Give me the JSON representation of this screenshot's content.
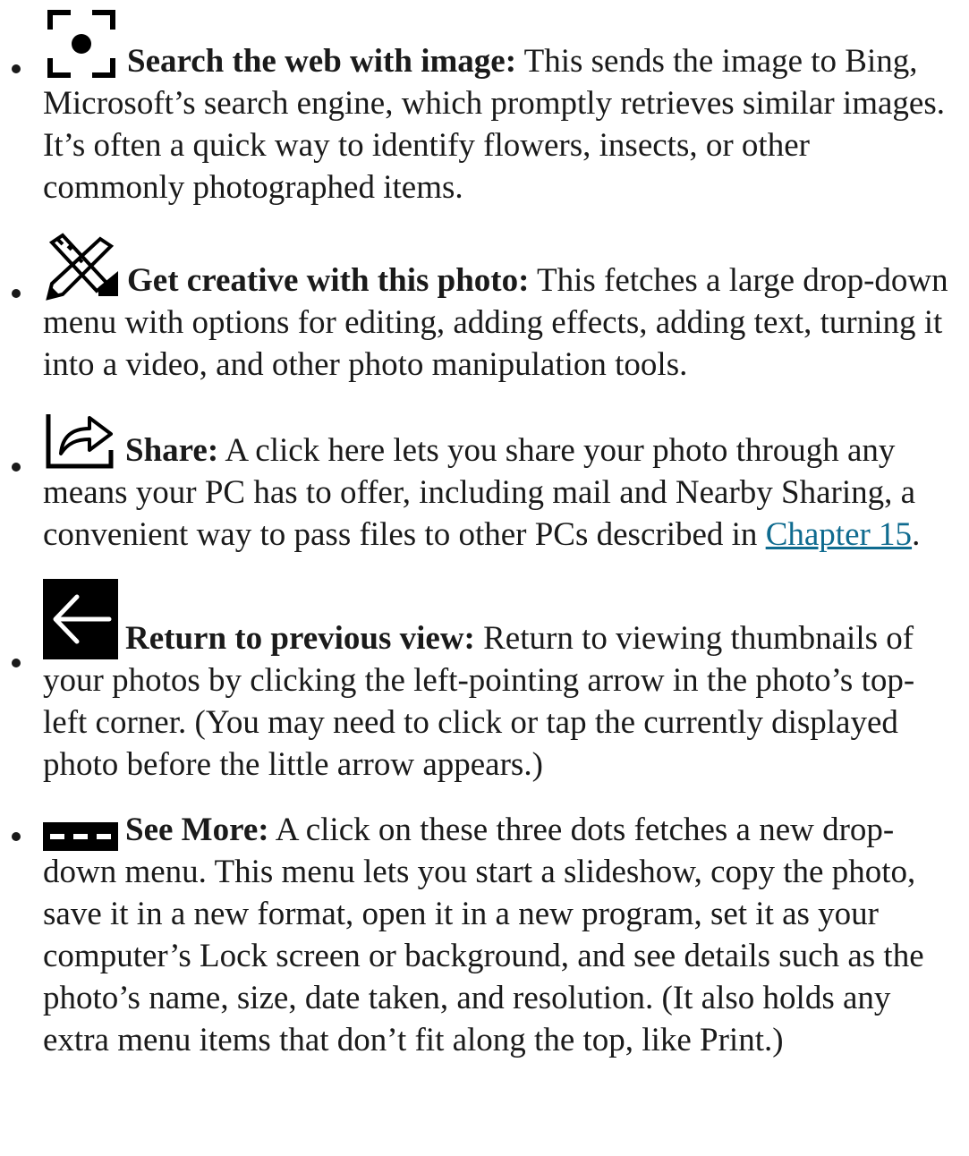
{
  "items": [
    {
      "icon": "visual-search-icon",
      "term": "Search the web with image:",
      "desc": " This sends the image to Bing, Microsoft’s search engine, which promptly retrieves similar images. It’s often a quick way to identify flowers, insects, or other commonly photographed items."
    },
    {
      "icon": "pencil-ruler-icon",
      "term": "Get creative with this photo:",
      "desc": " This fetches a large drop-down menu with options for editing, adding effects, adding text, turning it into a video, and other photo manipulation tools."
    },
    {
      "icon": "share-icon",
      "term": "Share:",
      "desc_before": " A click here lets you share your photo through any means your PC has to offer, including mail and Nearby Sharing, a convenient way to pass files to other PCs described in ",
      "link": "Chapter 15",
      "desc_after": "."
    },
    {
      "icon": "back-arrow-icon",
      "term": "Return to previous view:",
      "desc": " Return to viewing thumbnails of your photos by clicking the left-pointing arrow in the photo’s top-left corner. (You may need to click or tap the currently displayed photo before the little arrow appears.)"
    },
    {
      "icon": "more-dots-icon",
      "term": "See More:",
      "desc": " A click on these three dots fetches a new drop-down menu. This menu lets you start a slideshow, copy the photo, save it in a new format, open it in a new program, set it as your computer’s Lock screen or background, and see details such as the photo’s name, size, date taken, and resolution. (It also holds any extra menu items that don’t fit along the top, like Print.)"
    }
  ],
  "colors": {
    "text": "#1a1a1a",
    "link": "#0f6b8f",
    "icon": "#000000"
  }
}
